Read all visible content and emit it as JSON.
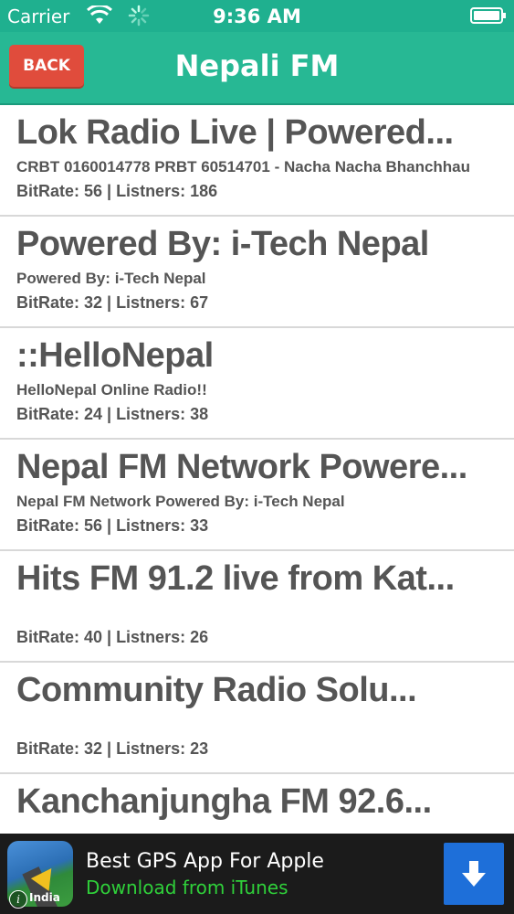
{
  "status_bar": {
    "carrier": "Carrier",
    "time": "9:36 AM"
  },
  "nav": {
    "back_label": "BACK",
    "title": "Nepali FM"
  },
  "stations": [
    {
      "title": "Lok Radio Live | Powered...",
      "desc": "CRBT 0160014778 PRBT 60514701 - Nacha Nacha Bhanchhau",
      "meta": "BitRate: 56 | Listners: 186"
    },
    {
      "title": "Powered By: i-Tech Nepal",
      "desc": "Powered By: i-Tech Nepal",
      "meta": "BitRate: 32 | Listners: 67"
    },
    {
      "title": "::HelloNepal",
      "desc": "HelloNepal Online Radio!!",
      "meta": "BitRate: 24 | Listners: 38"
    },
    {
      "title": "Nepal FM Network Powere...",
      "desc": "Nepal FM Network Powered By: i-Tech Nepal",
      "meta": "BitRate: 56 | Listners: 33"
    },
    {
      "title": "Hits FM 91.2 live from Kat...",
      "desc": "",
      "meta": "BitRate: 40 | Listners: 26"
    },
    {
      "title": "Community Radio Solu...",
      "desc": "",
      "meta": "BitRate: 32 | Listners: 23"
    },
    {
      "title": "Kanchanjungha FM 92.6...",
      "desc": "",
      "meta": ""
    }
  ],
  "ad": {
    "title": "Best GPS App For Apple",
    "subtitle": "Download from iTunes",
    "region": "India"
  },
  "colors": {
    "nav_green": "#27b894",
    "back_red": "#e04c3c",
    "ad_green": "#2fd03a",
    "ad_blue": "#1e6fd9"
  }
}
